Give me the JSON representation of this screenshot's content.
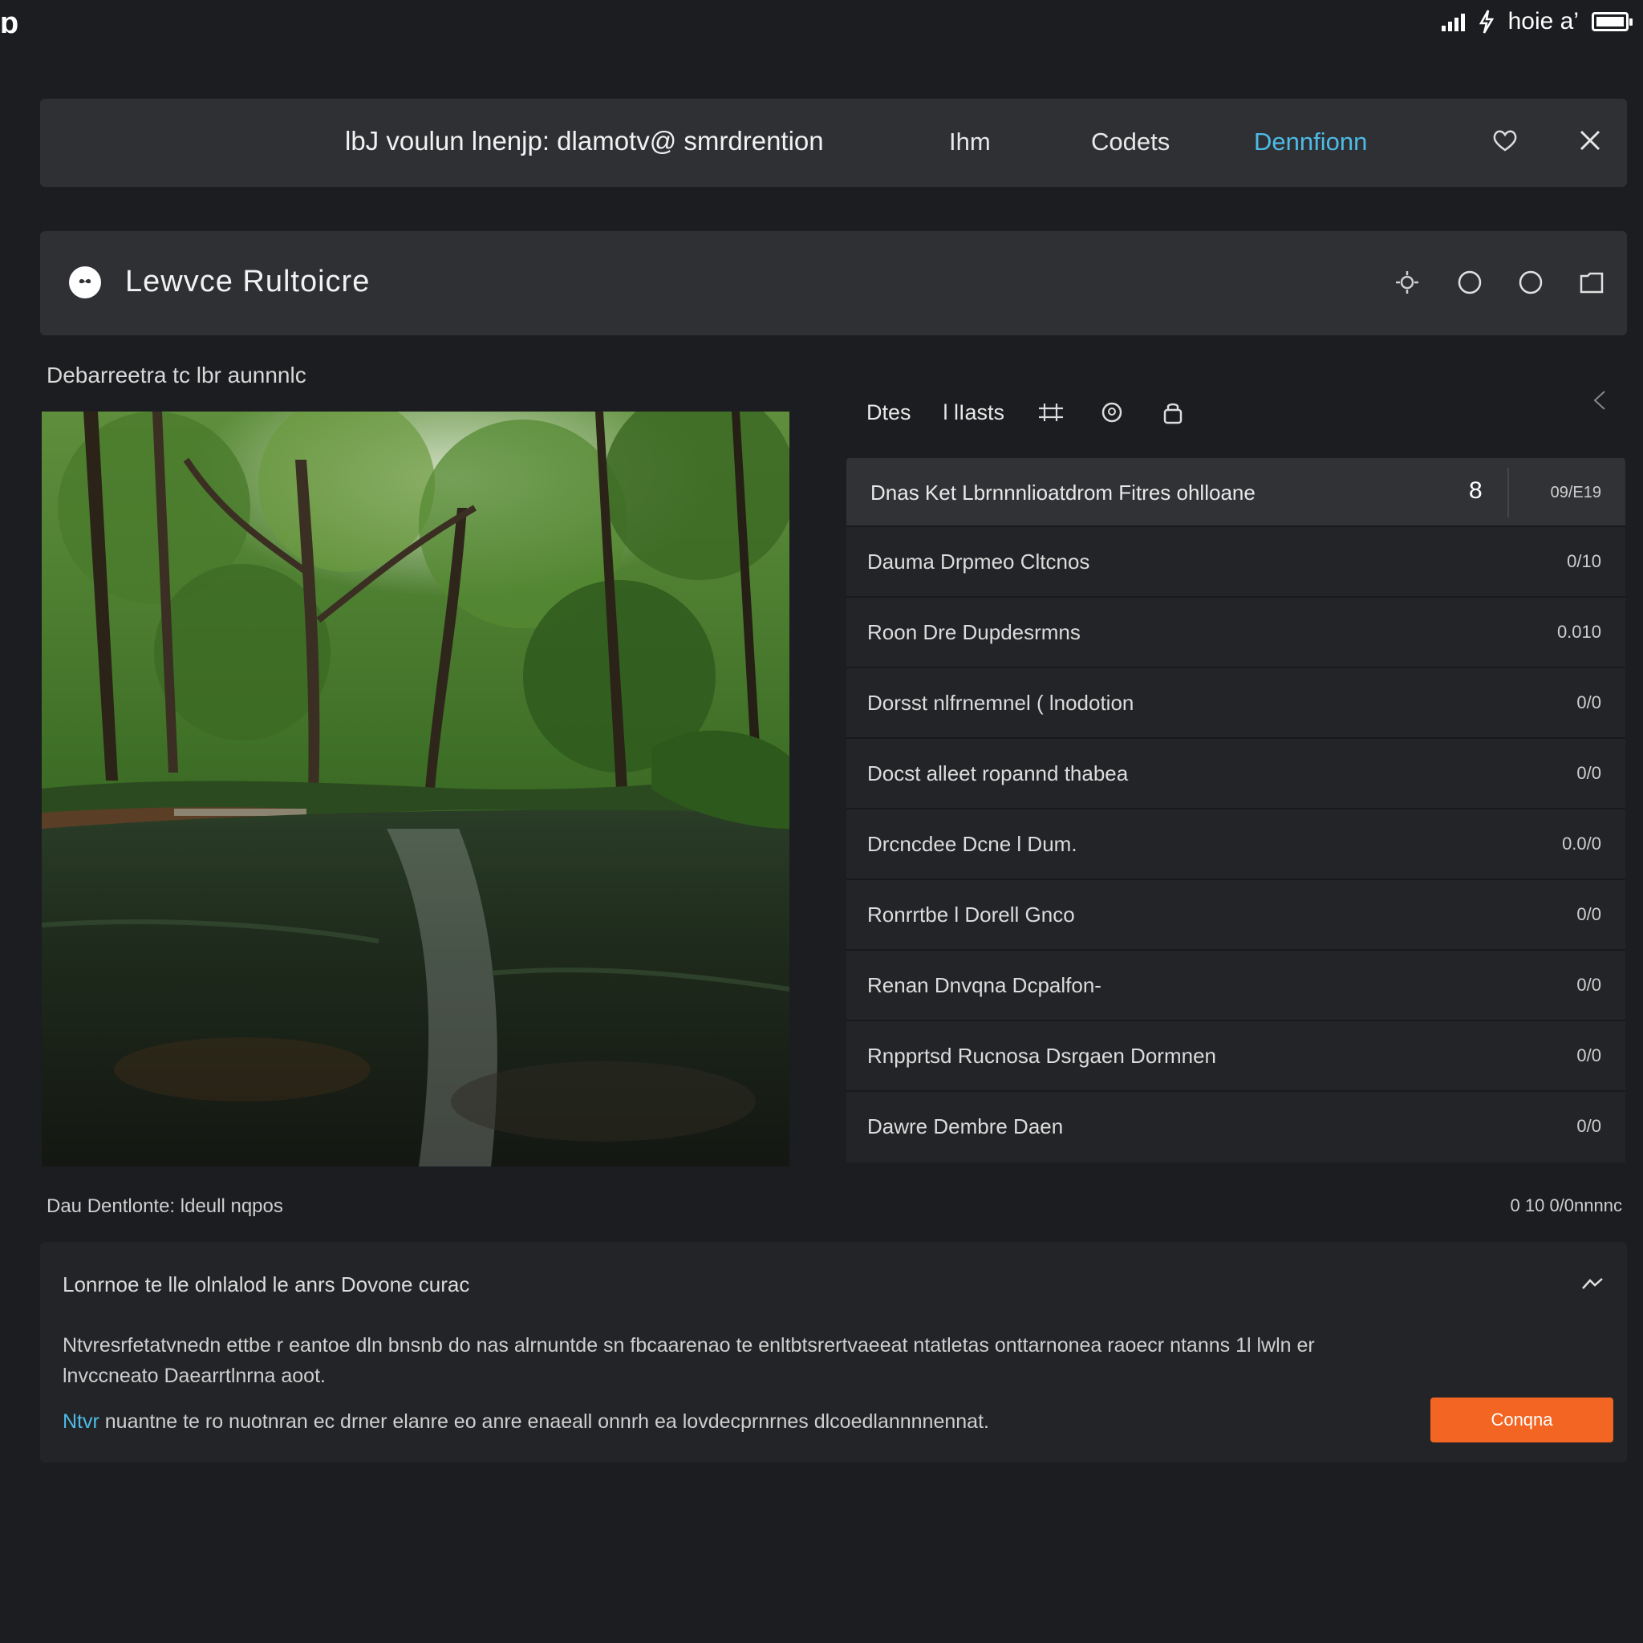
{
  "status_bar": {
    "logo": "ɒ",
    "carrier_text": "hoie a’"
  },
  "top_nav": {
    "title": "lbJ voulun lnenjp: dlamotv@ smrdrention",
    "tabs": [
      {
        "label": "Ihm",
        "active": false
      },
      {
        "label": "Codets",
        "active": false
      },
      {
        "label": "Dennfionn",
        "active": true
      }
    ]
  },
  "section": {
    "title": "Lewvce  Rultoicre"
  },
  "image_caption": "Debarreetra tc lbr aunnnlc",
  "image": {
    "description_icon": "forest-river-photo"
  },
  "panel": {
    "tabs": [
      {
        "label": "Dtes"
      },
      {
        "label": "l lIasts"
      }
    ],
    "header_row": {
      "label": "Dnas Ket Lbrnnnlioatdrom Fitres ohlloane",
      "count": "8",
      "extra": "09/E19"
    },
    "rows": [
      {
        "label": "Dauma Drpmeo Cltcnos",
        "value": "0/10"
      },
      {
        "label": "Roon Dre Dupdesrmns",
        "value": "0.010"
      },
      {
        "label": "Dorsst nlfrnemnel ( lnodotion",
        "value": "0/0"
      },
      {
        "label": "Docst alleet ropannd thabea",
        "value": "0/0"
      },
      {
        "label": "Drcncdee  Dcne l Dum.",
        "value": "0.0/0"
      },
      {
        "label": "Ronrrtbe l Dorell Gnco",
        "value": "0/0"
      },
      {
        "label": "Renan Dnvqna Dcpalfon-",
        "value": "0/0"
      },
      {
        "label": "Rnpprtsd Rucnosa Dsrgaen Dormnen",
        "value": "0/0"
      },
      {
        "label": "Dawre Dembre Daen",
        "value": "0/0"
      }
    ]
  },
  "footnote": {
    "left": "Dau Dentlonte: ldeull nqpos",
    "right": "0 10 0/0nnnnc"
  },
  "info_card": {
    "title": "Lonrnoe te lle olnlalod le anrs  Dovone curac",
    "body": "Ntvresrfetatvnedn ettbe r eantoe dln bnsnb do nas alrnuntde sn fbcaarenao te enltbtsrertvaeeat ntatletas onttarnonea raoecr ntanns 1l lwln er lnvccneato Daearrtlnrna aoot.",
    "note_link": "Ntvr",
    "note": " nuantne te ro nuotnran ec drner elanre eo anre enaeall onnrh ea lovdecprnrnes dlcoedlannnnennat.",
    "button_label": "Conqna"
  }
}
